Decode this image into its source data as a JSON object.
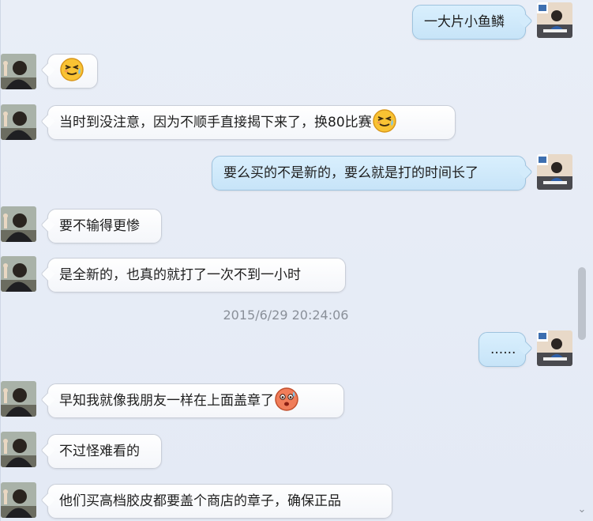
{
  "messages": [
    {
      "sender": "self",
      "text": "一大片小鱼鳞",
      "emoji": null
    },
    {
      "sender": "friend",
      "text": "",
      "emoji": "grimace-sweat"
    },
    {
      "sender": "friend",
      "text": "当时到没注意，因为不顺手直接揭下来了，换80比赛",
      "emoji": "grimace-sweat"
    },
    {
      "sender": "self",
      "text": "要么买的不是新的，要么就是打的时间长了",
      "emoji": null
    },
    {
      "sender": "friend",
      "text": "要不输得更惨",
      "emoji": null
    },
    {
      "sender": "friend",
      "text": "是全新的，也真的就打了一次不到一小时",
      "emoji": null
    },
    {
      "sender": "self",
      "text": "......",
      "emoji": null
    },
    {
      "sender": "friend",
      "text": "早知我就像我朋友一样在上面盖章了",
      "emoji": "embarrassed-sweat"
    },
    {
      "sender": "friend",
      "text": "不过怪难看的",
      "emoji": null
    },
    {
      "sender": "friend",
      "text": "他们买高档胶皮都要盖个商店的章子，确保正品",
      "emoji": null
    }
  ],
  "timestamp": "2015/6/29 20:24:06",
  "scroll": {
    "down_glyph": "⌄",
    "position_fraction": 0.62
  },
  "colors": {
    "background": "#e7ecf6",
    "friend_bubble": "#ffffff",
    "self_bubble": "#d2eafb",
    "timestamp_text": "#8a9099"
  }
}
